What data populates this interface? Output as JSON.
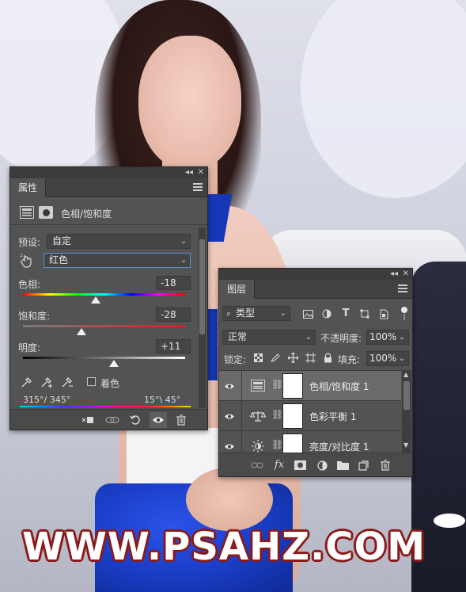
{
  "watermark": "WWW.PSAHZ.COM",
  "properties_panel": {
    "tab": "属性",
    "adjustment_title": "色相/饱和度",
    "preset_label": "预设:",
    "preset_value": "自定",
    "channel_value": "红色",
    "hue_label": "色相:",
    "hue_value": "-18",
    "saturation_label": "饱和度:",
    "saturation_value": "-28",
    "lightness_label": "明度:",
    "lightness_value": "+11",
    "colorize_label": "着色",
    "colorize_checked": false,
    "range_left": "315°/ 345°",
    "range_right": "15°\\ 45°",
    "hue_level": 0.45,
    "saturation_level": 0.36,
    "lightness_level": 0.56
  },
  "layers_panel": {
    "tab": "图层",
    "filter_value": "类型",
    "blend_mode": "正常",
    "opacity_label": "不透明度:",
    "opacity_value": "100%",
    "lock_label": "锁定:",
    "fill_label": "填充:",
    "fill_value": "100%",
    "layers": [
      {
        "name": "色相/饱和度 1",
        "icon": "hue-saturation-icon",
        "selected": true
      },
      {
        "name": "色彩平衡 1",
        "icon": "color-balance-icon",
        "selected": false
      },
      {
        "name": "亮度/对比度 1",
        "icon": "brightness-contrast-icon",
        "selected": false
      }
    ]
  }
}
